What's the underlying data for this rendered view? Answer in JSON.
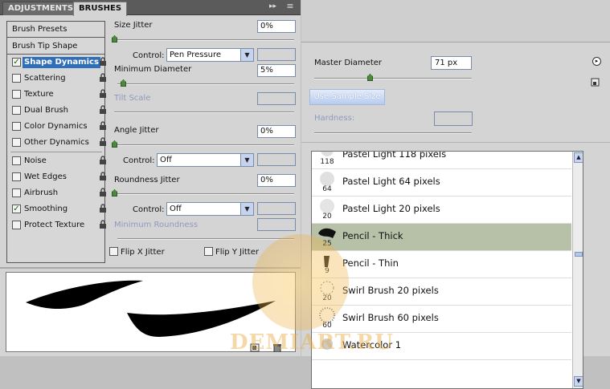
{
  "tabs": {
    "adjustments": "ADJUSTMENTS",
    "brushes": "BRUSHES"
  },
  "panel_controls": {
    "forward": "▸▸",
    "menu": "≡"
  },
  "categories": {
    "header_presets": "Brush Presets",
    "header_tip": "Brush Tip Shape",
    "items": [
      {
        "label": "Shape Dynamics",
        "checked": true,
        "selected": true
      },
      {
        "label": "Scattering",
        "checked": false
      },
      {
        "label": "Texture",
        "checked": false
      },
      {
        "label": "Dual Brush",
        "checked": false
      },
      {
        "label": "Color Dynamics",
        "checked": false
      },
      {
        "label": "Other Dynamics",
        "checked": false
      },
      {
        "label": "Noise",
        "checked": false
      },
      {
        "label": "Wet Edges",
        "checked": false
      },
      {
        "label": "Airbrush",
        "checked": false
      },
      {
        "label": "Smoothing",
        "checked": true
      },
      {
        "label": "Protect Texture",
        "checked": false
      }
    ],
    "check_mark": "✓"
  },
  "settings": {
    "size_jitter_label": "Size Jitter",
    "size_jitter_value": "0%",
    "size_control_label": "Control:",
    "size_control_value": "Pen Pressure",
    "min_diameter_label": "Minimum Diameter",
    "min_diameter_value": "5%",
    "tilt_scale_label": "Tilt Scale",
    "angle_jitter_label": "Angle Jitter",
    "angle_jitter_value": "0%",
    "angle_control_label": "Control:",
    "angle_control_value": "Off",
    "roundness_jitter_label": "Roundness Jitter",
    "roundness_jitter_value": "0%",
    "roundness_control_label": "Control:",
    "roundness_control_value": "Off",
    "min_roundness_label": "Minimum Roundness",
    "flip_x_label": "Flip X Jitter",
    "flip_y_label": "Flip Y Jitter",
    "dropdown_arrow": "▼"
  },
  "picker": {
    "master_diameter_label": "Master Diameter",
    "master_diameter_value": "71 px",
    "sample_size_button": "Use Sample Size",
    "hardness_label": "Hardness:",
    "menu_icon": "▸",
    "presets": [
      {
        "name": "Pastel Light 118 pixels",
        "size": "118"
      },
      {
        "name": "Pastel Light 64 pixels",
        "size": "64"
      },
      {
        "name": "Pastel Light 20 pixels",
        "size": "20"
      },
      {
        "name": "Pencil - Thick",
        "size": "25",
        "selected": true
      },
      {
        "name": "Pencil - Thin",
        "size": "9"
      },
      {
        "name": "Swirl Brush 20 pixels",
        "size": "20"
      },
      {
        "name": "Swirl Brush 60 pixels",
        "size": "60"
      },
      {
        "name": "Watercolor 1",
        "size": ""
      }
    ],
    "scroll_up": "▲",
    "scroll_down": "▼"
  },
  "watermark": {
    "text": "DEMIART.RU"
  },
  "colors": {
    "accent": "#2f6fb8",
    "selected_row": "#b7c1a8",
    "slider_knob": "#4b8a3a"
  }
}
